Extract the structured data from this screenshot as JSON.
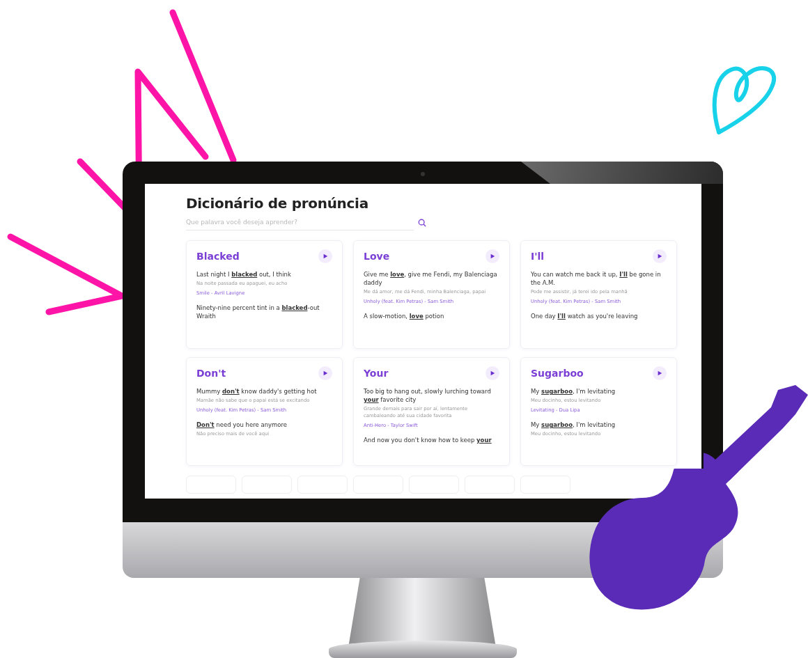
{
  "page": {
    "title": "Dicionário de pronúncia",
    "search": {
      "placeholder": "Que palavra você deseja aprender?"
    }
  },
  "cards": [
    {
      "word": "Blacked",
      "examples": [
        {
          "lyric": "Last night I **blacked** out, I think",
          "translation": "Na noite passada eu apaguei, eu acho",
          "song": "Smile - Avril Lavigne"
        },
        {
          "lyric": "Ninety-nine percent tint in a **blacked**-out Wraith"
        }
      ]
    },
    {
      "word": "Love",
      "examples": [
        {
          "lyric": "Give me **love**, give me Fendi, my Balenciaga daddy",
          "translation": "Me dá amor, me dá Fendi, minha Balenciaga, papai",
          "song": "Unholy (feat. Kim Petras) - Sam Smith"
        },
        {
          "lyric": "A slow-motion, **love** potion"
        }
      ]
    },
    {
      "word": "I'll",
      "examples": [
        {
          "lyric": "You can watch me back it up, **I'll** be gone in the A.M.",
          "translation": "Pode me assistir, já terei ido pela manhã",
          "song": "Unholy (feat. Kim Petras) - Sam Smith"
        },
        {
          "lyric": "One day **I'll** watch as you're leaving"
        }
      ]
    },
    {
      "word": "Don't",
      "examples": [
        {
          "lyric": "Mummy **don't** know daddy's getting hot",
          "translation": "Mamãe não sabe que o papai está se excitando",
          "song": "Unholy (feat. Kim Petras) - Sam Smith"
        },
        {
          "lyric": "**Don't** need you here anymore",
          "translation": "Não preciso mais de você aqui"
        }
      ]
    },
    {
      "word": "Your",
      "examples": [
        {
          "lyric": "Too big to hang out, slowly lurching toward **your** favorite city",
          "translation": "Grande demais para sair por aí, lentamente cambaleando até sua cidade favorita",
          "song": "Anti-Hero - Taylor Swift"
        },
        {
          "lyric": "And now you don't know how to keep **your**"
        }
      ]
    },
    {
      "word": "Sugarboo",
      "examples": [
        {
          "lyric": "My **sugarboo**, I'm levitating",
          "translation": "Meu docinho, estou levitando",
          "song": "Levitating - Dua Lipa"
        },
        {
          "lyric": "My **sugarboo**, I'm levitating",
          "translation": "Meu docinho, estou levitando"
        }
      ]
    }
  ]
}
